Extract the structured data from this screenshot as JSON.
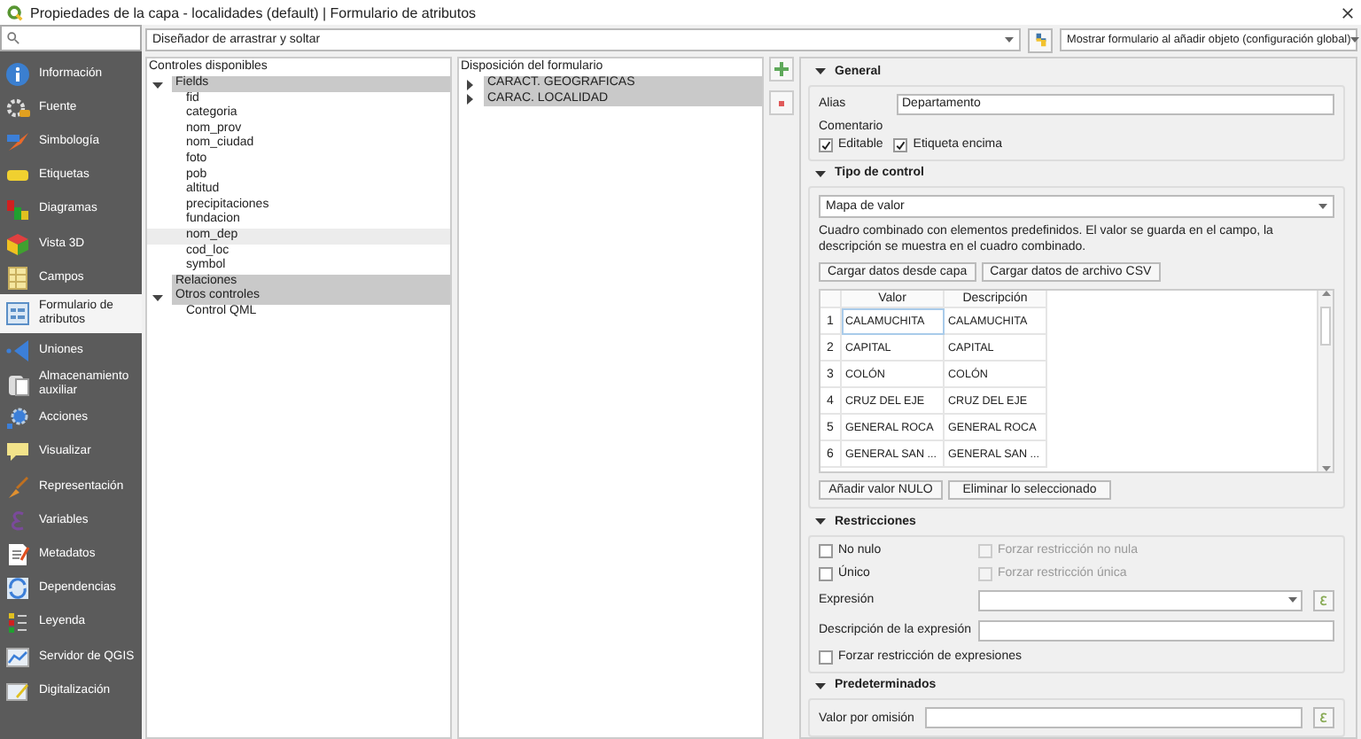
{
  "window": {
    "title": "Propiedades de la capa - localidades (default) | Formulario de atributos"
  },
  "sidebar": {
    "items": [
      {
        "label": "Información",
        "selected": false
      },
      {
        "label": "Fuente",
        "selected": false
      },
      {
        "label": "Simbología",
        "selected": false
      },
      {
        "label": "Etiquetas",
        "selected": false
      },
      {
        "label": "Diagramas",
        "selected": false
      },
      {
        "label": "Vista 3D",
        "selected": false
      },
      {
        "label": "Campos",
        "selected": false
      },
      {
        "label": "Formulario de atributos",
        "selected": true
      },
      {
        "label": "Uniones",
        "selected": false
      },
      {
        "label": "Almacenamiento auxiliar",
        "selected": false
      },
      {
        "label": "Acciones",
        "selected": false
      },
      {
        "label": "Visualizar",
        "selected": false
      },
      {
        "label": "Representación",
        "selected": false
      },
      {
        "label": "Variables",
        "selected": false
      },
      {
        "label": "Metadatos",
        "selected": false
      },
      {
        "label": "Dependencias",
        "selected": false
      },
      {
        "label": "Leyenda",
        "selected": false
      },
      {
        "label": "Servidor de QGIS",
        "selected": false
      },
      {
        "label": "Digitalización",
        "selected": false
      }
    ]
  },
  "toolbar": {
    "editor_layout": "Diseñador de arrastrar y soltar",
    "suppress_form": "Mostrar formulario al añadir objeto (configuración global)"
  },
  "available_controls": {
    "title": "Controles disponibles",
    "tree": [
      {
        "label": "Fields",
        "expanded": true,
        "selected": false,
        "children": [
          {
            "label": "fid",
            "selected": false
          },
          {
            "label": "categoria",
            "selected": false
          },
          {
            "label": "nom_prov",
            "selected": false
          },
          {
            "label": "nom_ciudad",
            "selected": false
          },
          {
            "label": "foto",
            "selected": false
          },
          {
            "label": "pob",
            "selected": false
          },
          {
            "label": "altitud",
            "selected": false
          },
          {
            "label": "precipitaciones",
            "selected": false
          },
          {
            "label": "fundacion",
            "selected": false
          },
          {
            "label": "nom_dep",
            "selected": true
          },
          {
            "label": "cod_loc",
            "selected": false
          },
          {
            "label": "symbol",
            "selected": false
          }
        ]
      },
      {
        "label": "Relaciones",
        "selected": false
      },
      {
        "label": "Otros controles",
        "expanded": true,
        "selected": false,
        "children": [
          {
            "label": "Control QML",
            "selected": false
          }
        ]
      }
    ]
  },
  "form_layout": {
    "title": "Disposición del formulario",
    "tree": [
      {
        "label": "CARACT. GEOGRAFICAS",
        "expanded": false,
        "selected": false
      },
      {
        "label": "CARAC. LOCALIDAD",
        "expanded": false,
        "selected": false
      }
    ]
  },
  "general": {
    "title": "General",
    "expanded": true,
    "alias_label": "Alias",
    "alias": "Departamento",
    "comment_label": "Comentario",
    "checkboxes": [
      {
        "label": "Editable",
        "checked": true
      },
      {
        "label": "Etiqueta encima",
        "checked": true
      }
    ]
  },
  "widget_type": {
    "title": "Tipo de control",
    "expanded": true,
    "type": "Mapa de valor",
    "description": "Cuadro combinado con elementos predefinidos. El valor se guarda en el campo, la descripción se muestra en el cuadro combinado.",
    "load_buttons": [
      "Cargar datos desde capa",
      "Cargar datos de archivo CSV"
    ],
    "table": {
      "columns": [
        "Valor",
        "Descripción"
      ],
      "rows": [
        {
          "number": "1",
          "cells": [
            "CALAMUCHITA",
            "CALAMUCHITA"
          ],
          "current": true
        },
        {
          "number": "2",
          "cells": [
            "CAPITAL",
            "CAPITAL"
          ],
          "current": false
        },
        {
          "number": "3",
          "cells": [
            "COLÓN",
            "COLÓN"
          ],
          "current": false
        },
        {
          "number": "4",
          "cells": [
            "CRUZ DEL EJE",
            "CRUZ DEL EJE"
          ],
          "current": false
        },
        {
          "number": "5",
          "cells": [
            "GENERAL ROCA",
            "GENERAL ROCA"
          ],
          "current": false
        },
        {
          "number": "6",
          "cells": [
            "GENERAL SAN ...",
            "GENERAL SAN ..."
          ],
          "current": false
        }
      ]
    },
    "actions": [
      "Añadir valor NULO",
      "Eliminar lo seleccionado"
    ]
  },
  "constraints": {
    "title": "Restricciones",
    "expanded": true,
    "checks": [
      {
        "label": "No nulo",
        "checked": false,
        "disabled": false
      },
      {
        "label": "Forzar restricción no nula",
        "checked": false,
        "disabled": true
      },
      {
        "label": "Único",
        "checked": false,
        "disabled": false
      },
      {
        "label": "Forzar restricción única",
        "checked": false,
        "disabled": true
      }
    ],
    "expression_label": "Expresión",
    "description_label": "Descripción de la expresión",
    "enforce": {
      "label": "Forzar restricción de expresiones",
      "checked": false
    }
  },
  "defaults": {
    "title": "Predeterminados",
    "expanded": true,
    "default_label": "Valor por omisión"
  }
}
